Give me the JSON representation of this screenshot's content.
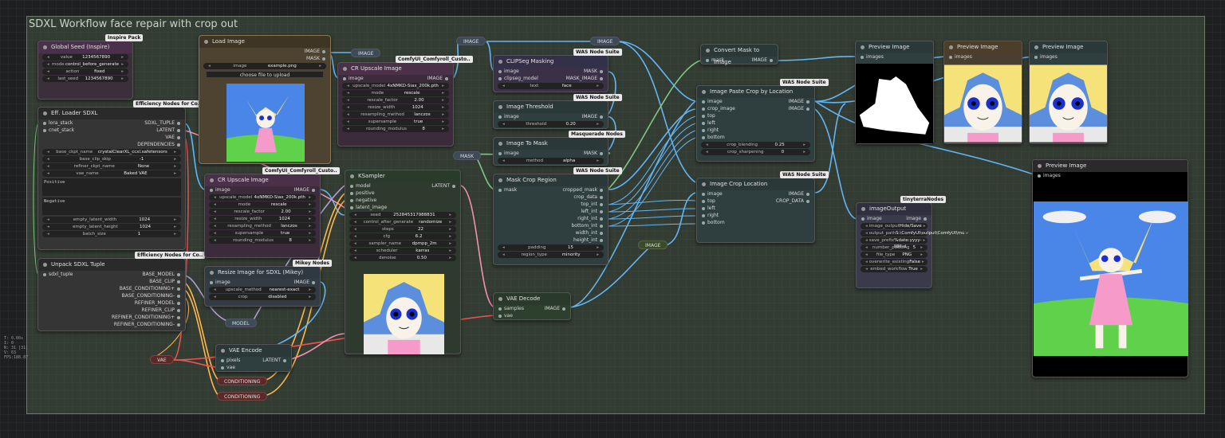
{
  "group": {
    "title": "SDXL Workflow face repair with crop out"
  },
  "hud": [
    "T: 0.00s",
    "I: 0",
    "N: 31 [31]",
    "V: 63",
    "FPS:188.87"
  ],
  "badges": {
    "inspire": "Inspire Pack",
    "efficiency1": "Efficiency Nodes for Co..",
    "efficiency2": "Efficiency Nodes for Co..",
    "comfyroll1": "ComfyUI_Comfyroll_Custo..",
    "comfyroll2": "ComfyUI_Comfyroll_Custo..",
    "was1": "WAS Node Suite",
    "was2": "WAS Node Suite",
    "was3": "WAS Node Suite",
    "was4": "WAS Node Suite",
    "was5": "WAS Node Suite",
    "mikey": "Mikey Nodes",
    "masquerade": "Masquerade Nodes",
    "tinyterra": "tinyterraNodes"
  },
  "nodes": {
    "global_seed": {
      "title": "Global Seed (Inspire)",
      "widgets": [
        {
          "k": "value",
          "v": "1234567890"
        },
        {
          "k": "mode",
          "v": "control_before_generate"
        },
        {
          "k": "action",
          "v": "fixed"
        },
        {
          "k": "last_seed",
          "v": "1234567890"
        }
      ]
    },
    "load_image": {
      "title": "Load Image",
      "outputs": [
        "IMAGE",
        "MASK"
      ],
      "image_label": "image",
      "image_value": "example.png",
      "upload": "choose file to upload"
    },
    "eff_loader": {
      "title": "Eff. Loader SDXL",
      "inputs": [
        "lora_stack",
        "cnet_stack"
      ],
      "outputs": [
        "SDXL_TUPLE",
        "LATENT",
        "VAE",
        "DEPENDENCIES"
      ],
      "widgets": [
        {
          "k": "base_ckpt_name",
          "v": "crystalClearXL_ccxl.safetensors"
        },
        {
          "k": "base_clip_skip",
          "v": "-1"
        },
        {
          "k": "refiner_ckpt_name",
          "v": "None"
        },
        {
          "k": "vae_name",
          "v": "Baked VAE"
        }
      ],
      "positive": "Positive",
      "negative": "Negative",
      "widgets2": [
        {
          "k": "empty_latent_width",
          "v": "1024"
        },
        {
          "k": "empty_latent_height",
          "v": "1024"
        },
        {
          "k": "batch_size",
          "v": "1"
        }
      ]
    },
    "cr_upscale1": {
      "title": "CR Upscale Image",
      "io": [
        "image",
        "IMAGE"
      ],
      "widgets": [
        {
          "k": "upscale_model",
          "v": "4xNMKD-Siax_200k.pth"
        },
        {
          "k": "mode",
          "v": "rescale"
        },
        {
          "k": "rescale_factor",
          "v": "2.00"
        },
        {
          "k": "resize_width",
          "v": "1024"
        },
        {
          "k": "resampling_method",
          "v": "lanczos"
        },
        {
          "k": "supersample",
          "v": "true"
        },
        {
          "k": "rounding_modulus",
          "v": "8"
        }
      ]
    },
    "cr_upscale2": {
      "title": "CR Upscale Image",
      "io": [
        "image",
        "IMAGE"
      ],
      "widgets": [
        {
          "k": "upscale_model",
          "v": "4xNMKD-Siax_200k.pth"
        },
        {
          "k": "mode",
          "v": "rescale"
        },
        {
          "k": "rescale_factor",
          "v": "2.00"
        },
        {
          "k": "resize_width",
          "v": "1024"
        },
        {
          "k": "resampling_method",
          "v": "lanczos"
        },
        {
          "k": "supersample",
          "v": "true"
        },
        {
          "k": "rounding_modulus",
          "v": "8"
        }
      ]
    },
    "unpack": {
      "title": "Unpack SDXL Tuple",
      "input": "sdxl_tuple",
      "outputs": [
        "BASE_MODEL",
        "BASE_CLIP",
        "BASE_CONDITIONING+",
        "BASE_CONDITIONING-",
        "REFINER_MODEL",
        "REFINER_CLIP",
        "REFINER_CONDITIONING+",
        "REFINER_CONDITIONING-"
      ]
    },
    "resize": {
      "title": "Resize Image for SDXL (Mikey)",
      "io": [
        "image",
        "IMAGE"
      ],
      "widgets": [
        {
          "k": "upscale_method",
          "v": "nearest-exact"
        },
        {
          "k": "crop",
          "v": "disabled"
        }
      ]
    },
    "ksampler": {
      "title": "KSampler",
      "inputs": [
        "model",
        "positive",
        "negative",
        "latent_image"
      ],
      "output": "LATENT",
      "widgets": [
        {
          "k": "seed",
          "v": "252845317988831"
        },
        {
          "k": "control_after_generate",
          "v": "randomize"
        },
        {
          "k": "steps",
          "v": "22"
        },
        {
          "k": "cfg",
          "v": "6.2"
        },
        {
          "k": "sampler_name",
          "v": "dpmpp_2m"
        },
        {
          "k": "scheduler",
          "v": "karras"
        },
        {
          "k": "denoise",
          "v": "0.50"
        }
      ]
    },
    "vae_encode": {
      "title": "VAE Encode",
      "inputs": [
        "pixels",
        "vae"
      ],
      "output": "LATENT"
    },
    "clipseg": {
      "title": "CLIPSeg Masking",
      "inputs": [
        "image",
        "clipseg_model"
      ],
      "outputs": [
        "MASK",
        "MASK_IMAGE"
      ],
      "widgets": [
        {
          "k": "text",
          "v": "face"
        }
      ]
    },
    "threshold": {
      "title": "Image Threshold",
      "io": [
        "image",
        "IMAGE"
      ],
      "widgets": [
        {
          "k": "threshold",
          "v": "0.20"
        }
      ]
    },
    "img_to_mask": {
      "title": "Image To Mask",
      "io": [
        "image",
        "MASK"
      ],
      "widgets": [
        {
          "k": "method",
          "v": "alpha"
        }
      ]
    },
    "mask_crop": {
      "title": "Mask Crop Region",
      "input": "mask",
      "outputs": [
        "cropped_mask",
        "crop_data",
        "top_int",
        "left_int",
        "right_int",
        "bottom_int",
        "width_int",
        "height_int"
      ],
      "widgets": [
        {
          "k": "padding",
          "v": "15"
        },
        {
          "k": "region_type",
          "v": "minority"
        }
      ]
    },
    "vae_decode": {
      "title": "VAE Decode",
      "inputs": [
        "samples",
        "vae"
      ],
      "output": "IMAGE"
    },
    "convert_mask": {
      "title": "Convert Mask to Image",
      "io": [
        "mask",
        "IMAGE"
      ]
    },
    "paste_crop": {
      "title": "Image Paste Crop by Location",
      "inputs": [
        "image",
        "crop_image",
        "top",
        "left",
        "right",
        "bottom"
      ],
      "outputs": [
        "IMAGE",
        "IMAGE"
      ],
      "widgets": [
        {
          "k": "crop_blending",
          "v": "0.25"
        },
        {
          "k": "crop_sharpening",
          "v": "0"
        }
      ]
    },
    "crop_loc": {
      "title": "Image Crop Location",
      "inputs": [
        "image",
        "top",
        "left",
        "right",
        "bottom"
      ],
      "outputs": [
        "IMAGE",
        "CROP_DATA"
      ]
    },
    "preview1": {
      "title": "Preview Image",
      "input": "images"
    },
    "preview2": {
      "title": "Preview Image",
      "input": "images"
    },
    "preview3": {
      "title": "Preview Image",
      "input": "images"
    },
    "preview4": {
      "title": "Preview Image",
      "input": "images"
    },
    "image_output": {
      "title": "imageOutput",
      "io": [
        "image",
        "image"
      ],
      "widgets": [
        {
          "k": "image_output",
          "v": "Hide/Save"
        },
        {
          "k": "output_path",
          "v": "S:\\ComfyUI\\output\\ComfyUI\\mu"
        },
        {
          "k": "save_prefix",
          "v": "%date:yyyy-MM-d"
        },
        {
          "k": "number_padding",
          "v": "5"
        },
        {
          "k": "file_type",
          "v": "PNG"
        },
        {
          "k": "overwrite_existing",
          "v": "False"
        },
        {
          "k": "embed_workflow",
          "v": "True"
        }
      ]
    }
  },
  "pills": {
    "image_top1": "IMAGE",
    "image_top2": "IMAGE",
    "image_top3": "IMAGE",
    "mask": "MASK",
    "model": "MODEL",
    "vae": "VAE",
    "cond1": "CONDITIONING",
    "cond2": "CONDITIONING",
    "image_mid": "IMAGE"
  }
}
